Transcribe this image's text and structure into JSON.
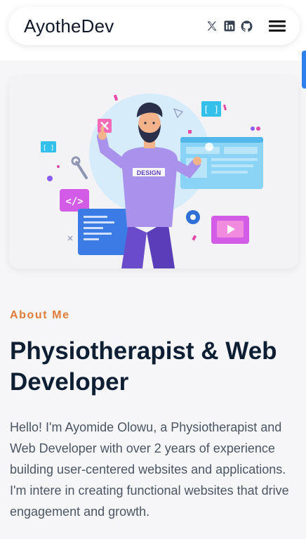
{
  "header": {
    "brand": "AyotheDev",
    "social": [
      {
        "icon": "x-twitter-icon"
      },
      {
        "icon": "linkedin-icon"
      },
      {
        "icon": "github-icon"
      }
    ],
    "menu_icon": "hamburger-menu-icon"
  },
  "hero": {
    "illustration_badge": "DESIGN"
  },
  "about": {
    "label": "About Me",
    "headline": "Physiotherapist & Web Developer",
    "bio": "Hello! I'm Ayomide Olowu, a Physiotherapist and Web Developer with over 2 years of experience building user-centered websites and applications. I'm intere in creating functional websites that drive engagement and growth."
  },
  "colors": {
    "accent": "#e07b39",
    "heading": "#0f1f33",
    "scroll_indicator": "#2f80ed"
  }
}
